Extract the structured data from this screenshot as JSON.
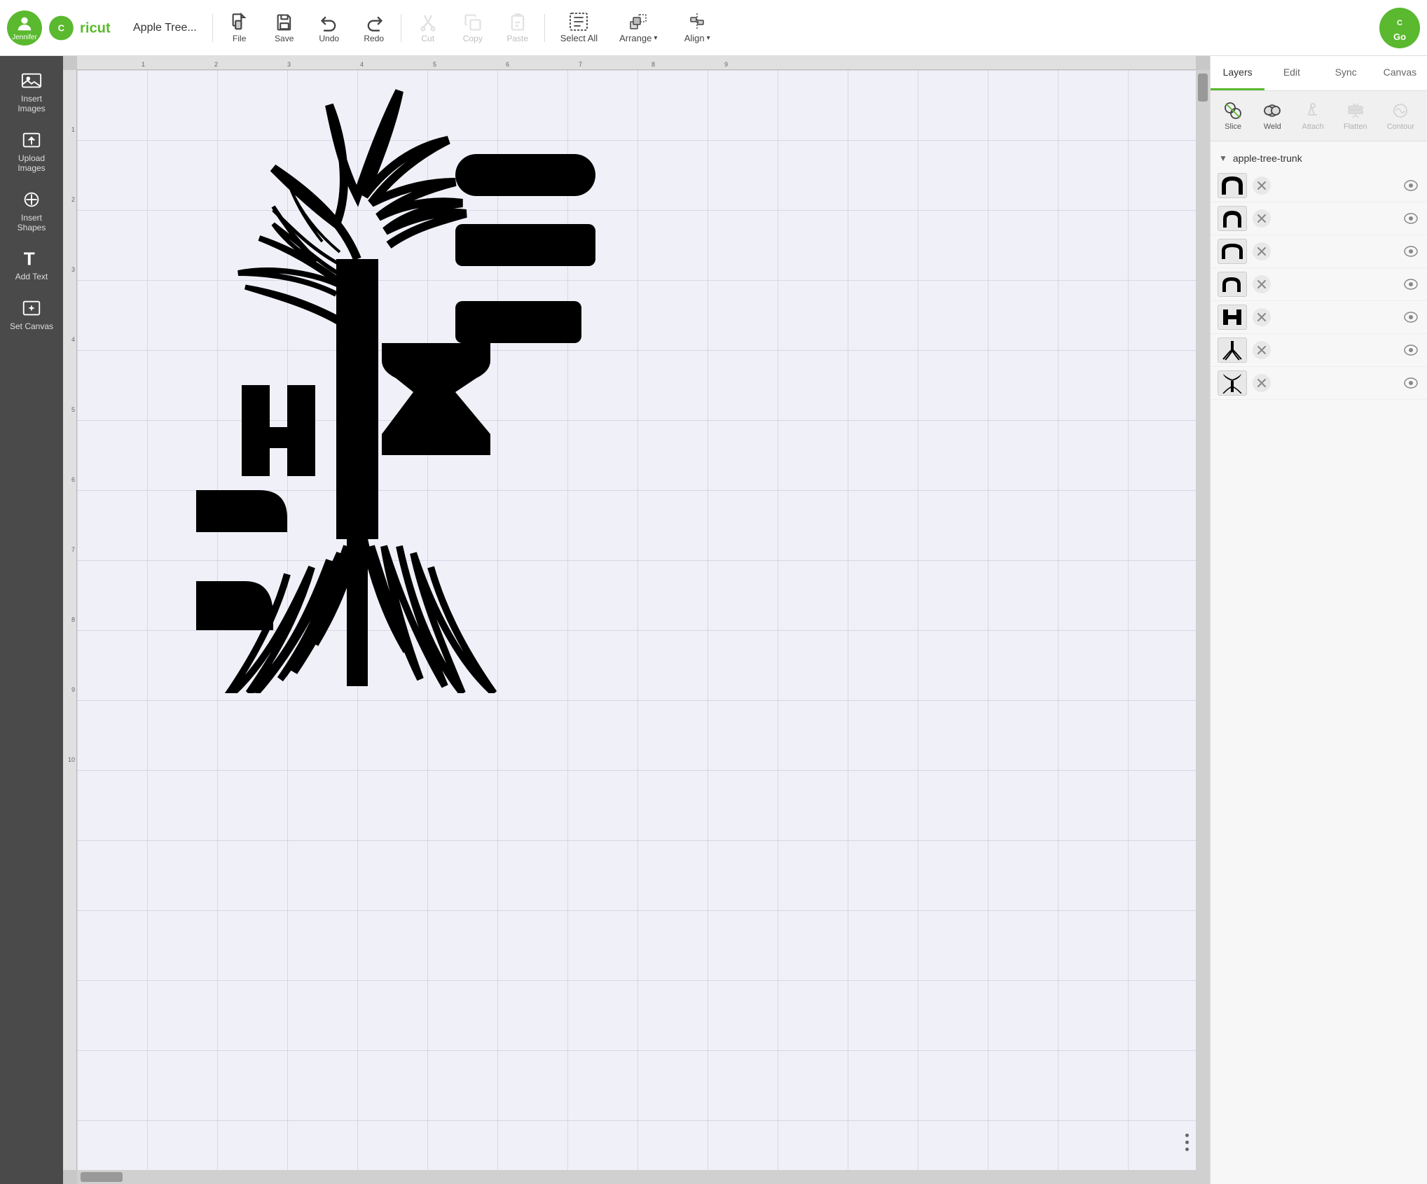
{
  "toolbar": {
    "user_name": "Jennifer",
    "project_name": "Apple Tree...",
    "file_label": "File",
    "save_label": "Save",
    "undo_label": "Undo",
    "redo_label": "Redo",
    "cut_label": "Cut",
    "copy_label": "Copy",
    "paste_label": "Paste",
    "select_all_label": "Select All",
    "arrange_label": "Arrange",
    "align_label": "Align",
    "go_label": "Go"
  },
  "sidebar": {
    "items": [
      {
        "id": "insert-images",
        "label": "Insert\nImages"
      },
      {
        "id": "upload-images",
        "label": "Upload\nImages"
      },
      {
        "id": "insert-shapes",
        "label": "Insert\nShapes"
      },
      {
        "id": "add-text",
        "label": "Add Text"
      },
      {
        "id": "set-canvas",
        "label": "Set Canvas"
      }
    ]
  },
  "right_panel": {
    "tabs": [
      {
        "id": "layers",
        "label": "Layers",
        "active": true
      },
      {
        "id": "edit",
        "label": "Edit",
        "active": false
      },
      {
        "id": "sync",
        "label": "Sync",
        "active": false
      },
      {
        "id": "canvas",
        "label": "Canvas",
        "active": false
      }
    ],
    "tools": [
      {
        "id": "slice",
        "label": "Slice",
        "enabled": true
      },
      {
        "id": "weld",
        "label": "Weld",
        "enabled": true
      },
      {
        "id": "attach",
        "label": "Attach",
        "enabled": false
      },
      {
        "id": "flatten",
        "label": "Flatten",
        "enabled": false
      },
      {
        "id": "contour",
        "label": "Contour",
        "enabled": false
      }
    ],
    "group_name": "apple-tree-trunk",
    "layers": [
      {
        "id": "layer-1",
        "thumb": "arch"
      },
      {
        "id": "layer-2",
        "thumb": "arch-small"
      },
      {
        "id": "layer-3",
        "thumb": "arch-med"
      },
      {
        "id": "layer-4",
        "thumb": "arch-corner"
      },
      {
        "id": "layer-5",
        "thumb": "letter-h"
      },
      {
        "id": "layer-6",
        "thumb": "tree-roots"
      },
      {
        "id": "layer-7",
        "thumb": "tree-full"
      }
    ]
  },
  "ruler": {
    "top_marks": [
      "1",
      "2",
      "3",
      "4",
      "5",
      "6",
      "7",
      "8",
      "9"
    ],
    "left_marks": [
      "1",
      "2",
      "3",
      "4",
      "5",
      "6",
      "7",
      "8",
      "9",
      "10"
    ]
  }
}
